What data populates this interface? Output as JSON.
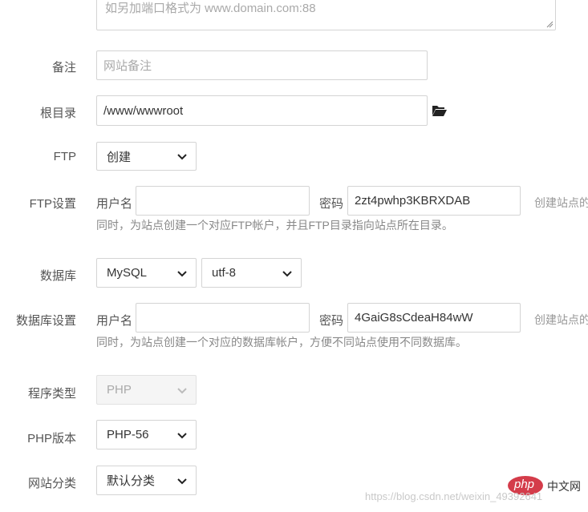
{
  "domain_textarea": {
    "placeholder": "如另加端口格式为 www.domain.com:88"
  },
  "remark": {
    "label": "备注",
    "placeholder": "网站备注"
  },
  "root_dir": {
    "label": "根目录",
    "value": "/www/wwwroot",
    "icon": "folder-open-icon"
  },
  "ftp": {
    "label": "FTP",
    "selected": "创建"
  },
  "ftp_settings": {
    "label": "FTP设置",
    "username_label": "用户名",
    "username_value": "",
    "password_label": "密码",
    "password_value": "2zt4pwhp3KBRXDAB",
    "side_text": "创建站点的",
    "hint": "同时，为站点创建一个对应FTP帐户，并且FTP目录指向站点所在目录。"
  },
  "database": {
    "label": "数据库",
    "type_selected": "MySQL",
    "charset_selected": "utf-8"
  },
  "db_settings": {
    "label": "数据库设置",
    "username_label": "用户名",
    "username_value": "",
    "password_label": "密码",
    "password_value": "4GaiG8sCdeaH84wW",
    "side_text": "创建站点的",
    "hint": "同时，为站点创建一个对应的数据库帐户，方便不同站点使用不同数据库。"
  },
  "program_type": {
    "label": "程序类型",
    "selected": "PHP",
    "disabled": true
  },
  "php_version": {
    "label": "PHP版本",
    "selected": "PHP-56"
  },
  "site_category": {
    "label": "网站分类",
    "selected": "默认分类"
  },
  "watermark": {
    "site": "php",
    "cn": "中文网",
    "url": "https://blog.csdn.net/weixin_49392641"
  }
}
